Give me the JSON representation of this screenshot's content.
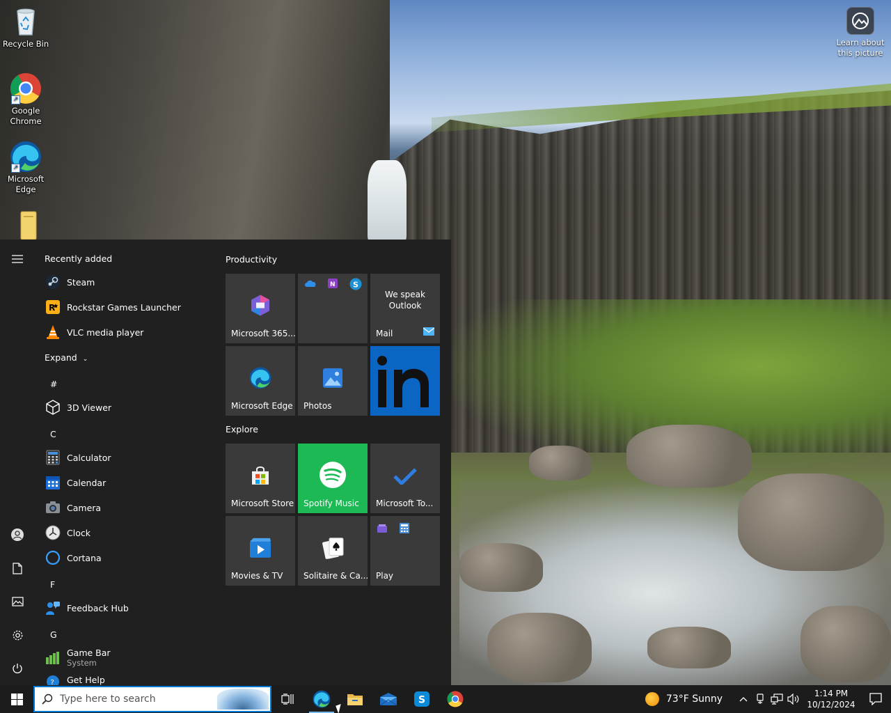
{
  "desktop": {
    "icons": [
      {
        "label": "Recycle Bin"
      },
      {
        "label": "Google Chrome"
      },
      {
        "label": "Microsoft Edge"
      },
      {
        "label": ""
      }
    ],
    "learn_picture": "Learn about this picture"
  },
  "start_menu": {
    "recently_added_label": "Recently added",
    "recent": [
      {
        "label": "Steam",
        "icon": "steam-icon"
      },
      {
        "label": "Rockstar Games Launcher",
        "icon": "rockstar-icon"
      },
      {
        "label": "VLC media player",
        "icon": "vlc-icon"
      }
    ],
    "expand_label": "Expand",
    "sections": [
      {
        "letter": "#",
        "apps": [
          {
            "label": "3D Viewer",
            "sub": ""
          }
        ]
      },
      {
        "letter": "C",
        "apps": [
          {
            "label": "Calculator",
            "sub": ""
          },
          {
            "label": "Calendar",
            "sub": ""
          },
          {
            "label": "Camera",
            "sub": ""
          },
          {
            "label": "Clock",
            "sub": ""
          },
          {
            "label": "Cortana",
            "sub": ""
          }
        ]
      },
      {
        "letter": "F",
        "apps": [
          {
            "label": "Feedback Hub",
            "sub": ""
          }
        ]
      },
      {
        "letter": "G",
        "apps": [
          {
            "label": "Game Bar",
            "sub": "System"
          },
          {
            "label": "Get Help",
            "sub": ""
          }
        ]
      }
    ],
    "groups": [
      {
        "title": "Productivity",
        "tiles": [
          {
            "label": "Microsoft 365...",
            "icon": "m365-icon"
          },
          {
            "label": "",
            "icon": "office-apps-icon"
          },
          {
            "label": "Mail",
            "icon": "mail-icon",
            "message": "We speak Outlook"
          },
          {
            "label": "Microsoft Edge",
            "icon": "edge-icon"
          },
          {
            "label": "Photos",
            "icon": "photos-icon"
          },
          {
            "label": "",
            "icon": "linkedin-icon"
          }
        ]
      },
      {
        "title": "Explore",
        "tiles": [
          {
            "label": "Microsoft Store",
            "icon": "store-icon"
          },
          {
            "label": "Spotify Music",
            "icon": "spotify-icon"
          },
          {
            "label": "Microsoft To...",
            "icon": "todo-icon"
          },
          {
            "label": "Movies & TV",
            "icon": "movies-icon"
          },
          {
            "label": "Solitaire & Ca...",
            "icon": "solitaire-icon"
          },
          {
            "label": "Play",
            "icon": "play-folder-icon"
          }
        ]
      }
    ]
  },
  "taskbar": {
    "search_placeholder": "Type here to search",
    "weather": "73°F  Sunny",
    "time": "1:14 PM",
    "date": "10/12/2024"
  },
  "colors": {
    "accent": "#0078d4",
    "spotify": "#1db954",
    "linkedin": "#0a66c2",
    "start_bg": "#202020",
    "tile_bg": "#3a3a3a"
  }
}
